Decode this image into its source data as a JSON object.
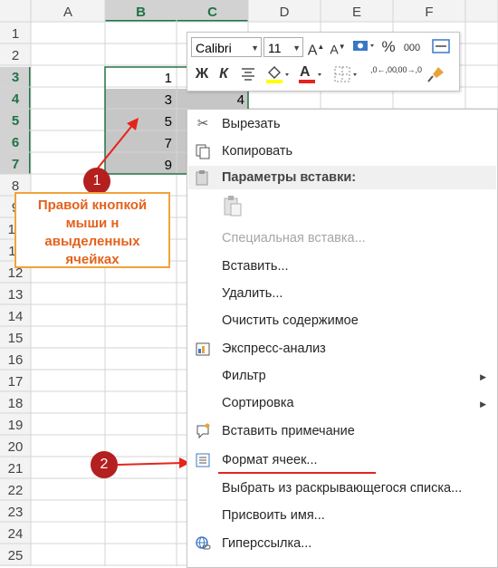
{
  "sheet": {
    "columns": [
      "A",
      "B",
      "C",
      "D",
      "E",
      "F"
    ],
    "rows": [
      "1",
      "2",
      "3",
      "4",
      "5",
      "6",
      "7",
      "8",
      "9",
      "10",
      "11",
      "12",
      "13",
      "14",
      "15",
      "16",
      "17",
      "18",
      "19",
      "20",
      "21",
      "22",
      "23",
      "24",
      "25"
    ],
    "cells_b": [
      "1",
      "3",
      "5",
      "7",
      "9"
    ],
    "cell_c4": "4",
    "selection_color": "#c6c6c6",
    "header_selected_color": "#217346"
  },
  "minibar": {
    "font_name": "Calibri",
    "font_size": "11",
    "grow_label": "A",
    "shrink_label": "A",
    "percent_label": "%",
    "thousands_label": "000",
    "bold_label": "Ж",
    "italic_label": "К",
    "font_color_label": "А",
    "dec_up_label": ",0←,00",
    "dec_down_label": ",00→,0"
  },
  "menu": {
    "cut": "Вырезать",
    "copy": "Копировать",
    "paste_options_header": "Параметры вставки:",
    "paste_special": "Специальная вставка...",
    "insert": "Вставить...",
    "delete": "Удалить...",
    "clear_contents": "Очистить содержимое",
    "quick_analysis": "Экспресс-анализ",
    "filter": "Фильтр",
    "sort": "Сортировка",
    "insert_comment": "Вставить примечание",
    "format_cells": "Формат ячеек...",
    "pick_from_list": "Выбрать из раскрывающегося списка...",
    "define_name": "Присвоить имя...",
    "hyperlink": "Гиперссылка..."
  },
  "annotations": {
    "badge1": "1",
    "badge2": "2",
    "callout_lines": [
      "Правой кнопкой",
      "мыши н",
      "авыделенных",
      "ячейках"
    ],
    "accent_red": "#e5241c",
    "callout_border": "#f0a33b"
  }
}
